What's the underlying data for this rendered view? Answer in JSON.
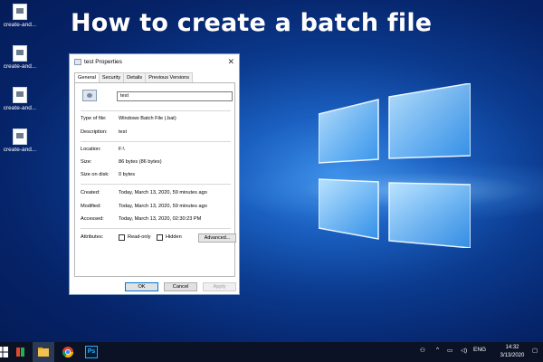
{
  "headline": "How to create a batch file",
  "desktop_icons": [
    {
      "label": "create-and...",
      "icon": "file-icon"
    },
    {
      "label": "create-and...",
      "icon": "file-icon"
    },
    {
      "label": "create-and...",
      "icon": "file-icon"
    },
    {
      "label": "create-and...",
      "icon": "file-icon"
    }
  ],
  "dialog": {
    "title": "test Properties",
    "tabs": [
      "General",
      "Security",
      "Details",
      "Previous Versions"
    ],
    "active_tab": "General",
    "file_name": "test",
    "type_label": "Type of file:",
    "type_value": "Windows Batch File (.bat)",
    "description_label": "Description:",
    "description_value": "test",
    "location_label": "Location:",
    "location_value": "F:\\",
    "size_label": "Size:",
    "size_value": "86 bytes (86 bytes)",
    "size_on_disk_label": "Size on disk:",
    "size_on_disk_value": "0 bytes",
    "created_label": "Created:",
    "created_value": "Today, March 13, 2020, 59 minutes ago",
    "modified_label": "Modified:",
    "modified_value": "Today, March 13, 2020, 59 minutes ago",
    "accessed_label": "Accessed:",
    "accessed_value": "Today, March 13, 2020, 02:30:23 PM",
    "attributes_label": "Attributes:",
    "readonly_label": "Read-only",
    "readonly_checked": false,
    "hidden_label": "Hidden",
    "hidden_checked": false,
    "advanced_label": "Advanced...",
    "ok_label": "OK",
    "cancel_label": "Cancel",
    "apply_label": "Apply"
  },
  "taskbar": {
    "apps": [
      "windows-start-icon",
      "cortana-icon",
      "file-explorer-icon",
      "chrome-icon",
      "photoshop-icon"
    ],
    "photoshop_label": "Ps",
    "language": "ENG",
    "time": "14:32",
    "date": "3/13/2020"
  },
  "colors": {
    "taskbar": "#0b1225",
    "accent": "#0078d7",
    "desktop_dark": "#041a55",
    "desktop_light": "#3b8ee8"
  }
}
